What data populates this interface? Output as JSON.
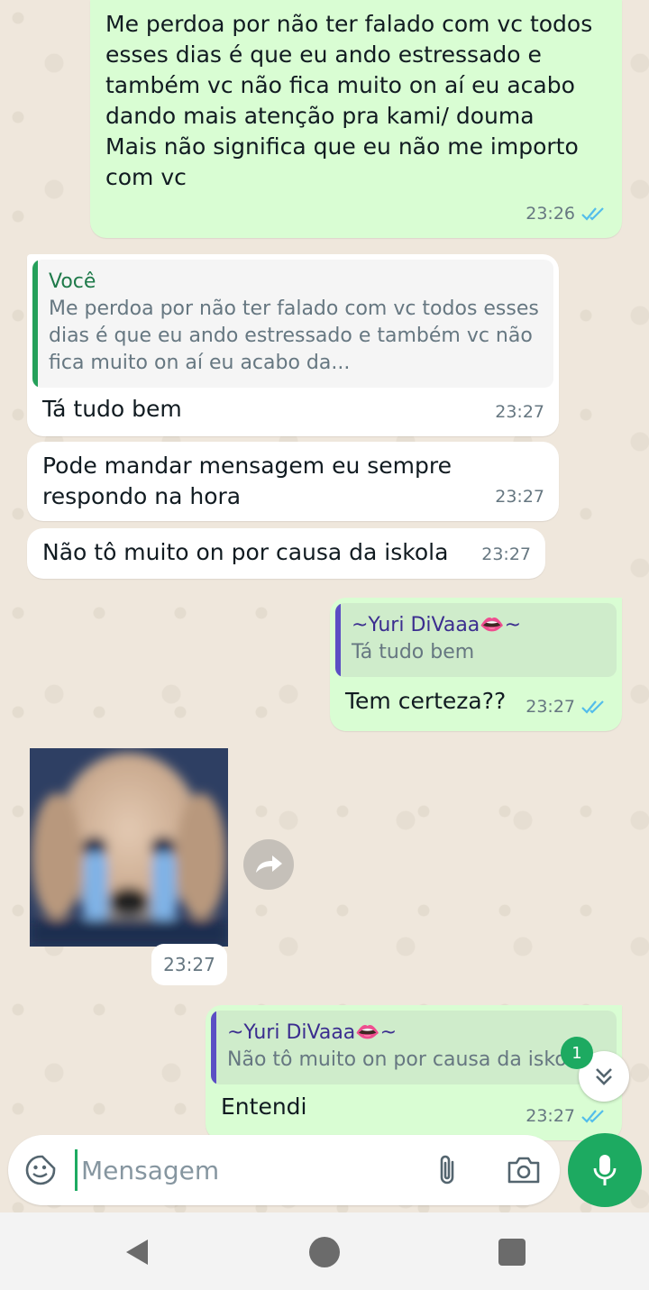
{
  "messages": {
    "m1": {
      "text": "Me perdoa por não ter falado com vc todos esses dias é que eu ando estressado e também vc não fica muito on aí eu acabo dando mais atenção pra kami/ douma\nMais não significa que eu não me importo com vc",
      "time": "23:26"
    },
    "m2": {
      "quote_author": "Você",
      "quote_text": "Me perdoa por não ter falado com vc todos esses dias é que eu ando estressado e também vc não fica muito on aí eu acabo da...",
      "text": "Tá tudo bem",
      "time": "23:27"
    },
    "m3": {
      "text": "Pode mandar mensagem eu sempre respondo na hora",
      "time": "23:27"
    },
    "m4": {
      "text": "Não tô muito on por causa da iskola",
      "time": "23:27"
    },
    "m5": {
      "quote_author": "~Yuri DiVaaa👄~",
      "quote_text": "Tá tudo bem",
      "text": "Tem certeza??",
      "time": "23:27"
    },
    "m6_image": {
      "time": "23:27"
    },
    "m7": {
      "quote_author": "~Yuri DiVaaa👄~",
      "quote_text": "Não tô muito on por causa da iskola",
      "text": "Entendi",
      "time": "23:27"
    }
  },
  "unread_count": "1",
  "composer": {
    "placeholder": "Mensagem"
  },
  "icons": {
    "emoji": "sticker-smiley-icon",
    "attach": "paperclip-icon",
    "camera": "camera-icon",
    "mic": "microphone-icon",
    "forward": "forward-icon",
    "scroll": "double-chevron-down-icon",
    "read": "double-check-icon"
  },
  "colors": {
    "outgoing_bubble": "#d9fdd3",
    "incoming_bubble": "#ffffff",
    "accent_green": "#1daa61",
    "read_ticks": "#53bdeb",
    "quote_bar_self": "#25a05a",
    "quote_bar_other": "#5b4ec4"
  }
}
